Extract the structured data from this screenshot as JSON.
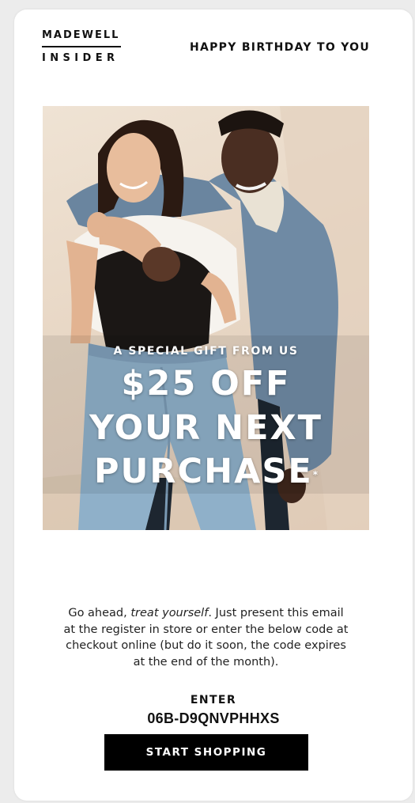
{
  "brand": {
    "logo_top": "MADEWELL",
    "logo_bottom": "INSIDER"
  },
  "header": {
    "tagline": "HAPPY BIRTHDAY TO YOU"
  },
  "hero": {
    "eyebrow": "A SPECIAL GIFT FROM US",
    "line1": "$25 OFF",
    "line2": "YOUR NEXT",
    "line3": "PURCHASE",
    "asterisk": "*"
  },
  "body": {
    "intro": "Go ahead, ",
    "emphasis": "treat yourself",
    "rest": ". Just present this email at the register in store or enter the below code at checkout online (but do it soon, the code expires at the end of the month)."
  },
  "code": {
    "label": "ENTER",
    "value": "06B-D9QNVPHHXS"
  },
  "cta": {
    "label": "START SHOPPING"
  },
  "colors": {
    "background": "#ececec",
    "card": "#ffffff",
    "text": "#111111",
    "button": "#000000",
    "button_text": "#ffffff",
    "hero_backdrop": "#e8d7c5"
  }
}
